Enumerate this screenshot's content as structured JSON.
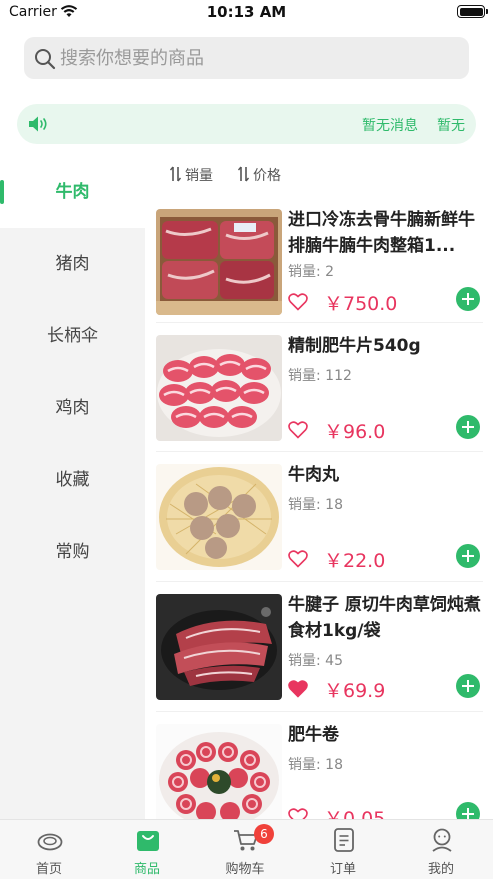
{
  "status_bar": {
    "carrier": "Carrier",
    "time": "10:13 AM",
    "battery_level": 1.0
  },
  "search": {
    "placeholder": "搜索你想要的商品"
  },
  "notice": {
    "message": "暂无消息",
    "message_repeat": "暂无"
  },
  "sidebar": {
    "items": [
      {
        "label": "牛肉",
        "active": true
      },
      {
        "label": "猪肉"
      },
      {
        "label": "长柄伞"
      },
      {
        "label": "鸡肉"
      },
      {
        "label": "收藏"
      },
      {
        "label": "常购"
      }
    ]
  },
  "sort": {
    "sales_label": "销量",
    "price_label": "价格"
  },
  "products": [
    {
      "name": "进口冷冻去骨牛腩新鲜牛排腩牛腩牛肉整箱1...",
      "sales_label": "销量:",
      "sales": "2",
      "price": "￥750.0",
      "favorited": false
    },
    {
      "name": "精制肥牛片540g",
      "sales_label": "销量:",
      "sales": "112",
      "price": "￥96.0",
      "favorited": false
    },
    {
      "name": "牛肉丸",
      "sales_label": "销量:",
      "sales": "18",
      "price": "￥22.0",
      "favorited": false
    },
    {
      "name": "牛腱子 原切牛肉草饲炖煮食材1kg/袋",
      "sales_label": "销量:",
      "sales": "45",
      "price": "￥69.9",
      "favorited": true
    },
    {
      "name": "肥牛卷",
      "sales_label": "销量:",
      "sales": "18",
      "price": "￥0.05",
      "favorited": false
    }
  ],
  "tabbar": {
    "items": [
      {
        "label": "首页",
        "icon": "home-icon"
      },
      {
        "label": "商品",
        "icon": "bag-icon",
        "active": true
      },
      {
        "label": "购物车",
        "icon": "cart-icon",
        "badge": "6"
      },
      {
        "label": "订单",
        "icon": "order-icon"
      },
      {
        "label": "我的",
        "icon": "profile-icon"
      }
    ]
  },
  "colors": {
    "accent": "#2fba6b",
    "price": "#e8355f",
    "badge": "#f0413a"
  }
}
